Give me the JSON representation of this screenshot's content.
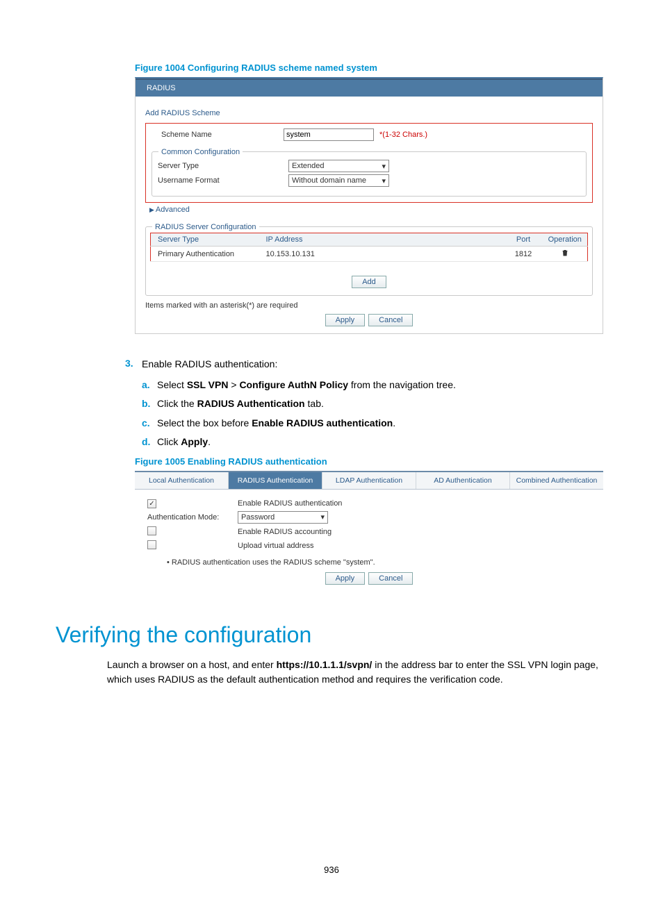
{
  "figure1004": {
    "caption": "Figure 1004 Configuring RADIUS scheme named system",
    "tabLabel": "RADIUS",
    "addSchemeTitle": "Add RADIUS Scheme",
    "schemeNameLabel": "Scheme Name",
    "schemeNameValue": "system",
    "schemeNameHint": "*(1-32 Chars.)",
    "commonConfigLabel": "Common Configuration",
    "serverTypeLabel": "Server Type",
    "serverTypeValue": "Extended",
    "usernameFormatLabel": "Username Format",
    "usernameFormatValue": "Without domain name",
    "advancedLabel": "Advanced",
    "radiusServerConfigLabel": "RADIUS Server Configuration",
    "tableHeaders": [
      "Server Type",
      "IP Address",
      "Port",
      "Operation"
    ],
    "tableRow": {
      "serverType": "Primary Authentication",
      "ip": "10.153.10.131",
      "port": "1812"
    },
    "addButton": "Add",
    "requiredNote": "Items marked with an asterisk(*) are required",
    "applyButton": "Apply",
    "cancelButton": "Cancel"
  },
  "steps": {
    "step3": "Enable RADIUS authentication:",
    "sub": {
      "a": {
        "pre": "Select ",
        "b1": "SSL VPN",
        "mid": " > ",
        "b2": "Configure AuthN Policy",
        "post": " from the navigation tree."
      },
      "b": {
        "pre": "Click the ",
        "b1": "RADIUS Authentication",
        "post": " tab."
      },
      "c": {
        "pre": "Select the box before ",
        "b1": "Enable RADIUS authentication",
        "post": "."
      },
      "d": {
        "pre": "Click ",
        "b1": "Apply",
        "post": "."
      }
    }
  },
  "figure1005": {
    "caption": "Figure 1005 Enabling RADIUS authentication",
    "tabs": [
      "Local Authentication",
      "RADIUS Authentication",
      "LDAP Authentication",
      "AD Authentication",
      "Combined Authentication"
    ],
    "enableRadiusLabel": "Enable RADIUS authentication",
    "authModeLabel": "Authentication Mode:",
    "authModeValue": "Password",
    "enableAcctLabel": "Enable RADIUS accounting",
    "uploadVAddrLabel": "Upload virtual address",
    "note": "RADIUS authentication uses the RADIUS scheme \"system\".",
    "applyButton": "Apply",
    "cancelButton": "Cancel"
  },
  "verify": {
    "heading": "Verifying the configuration",
    "para_pre": "Launch a browser on a host, and enter ",
    "para_bold": "https://10.1.1.1/svpn/",
    "para_post": " in the address bar to enter the SSL VPN login page, which uses RADIUS as the default authentication method and requires the verification code."
  },
  "pageNumber": "936"
}
